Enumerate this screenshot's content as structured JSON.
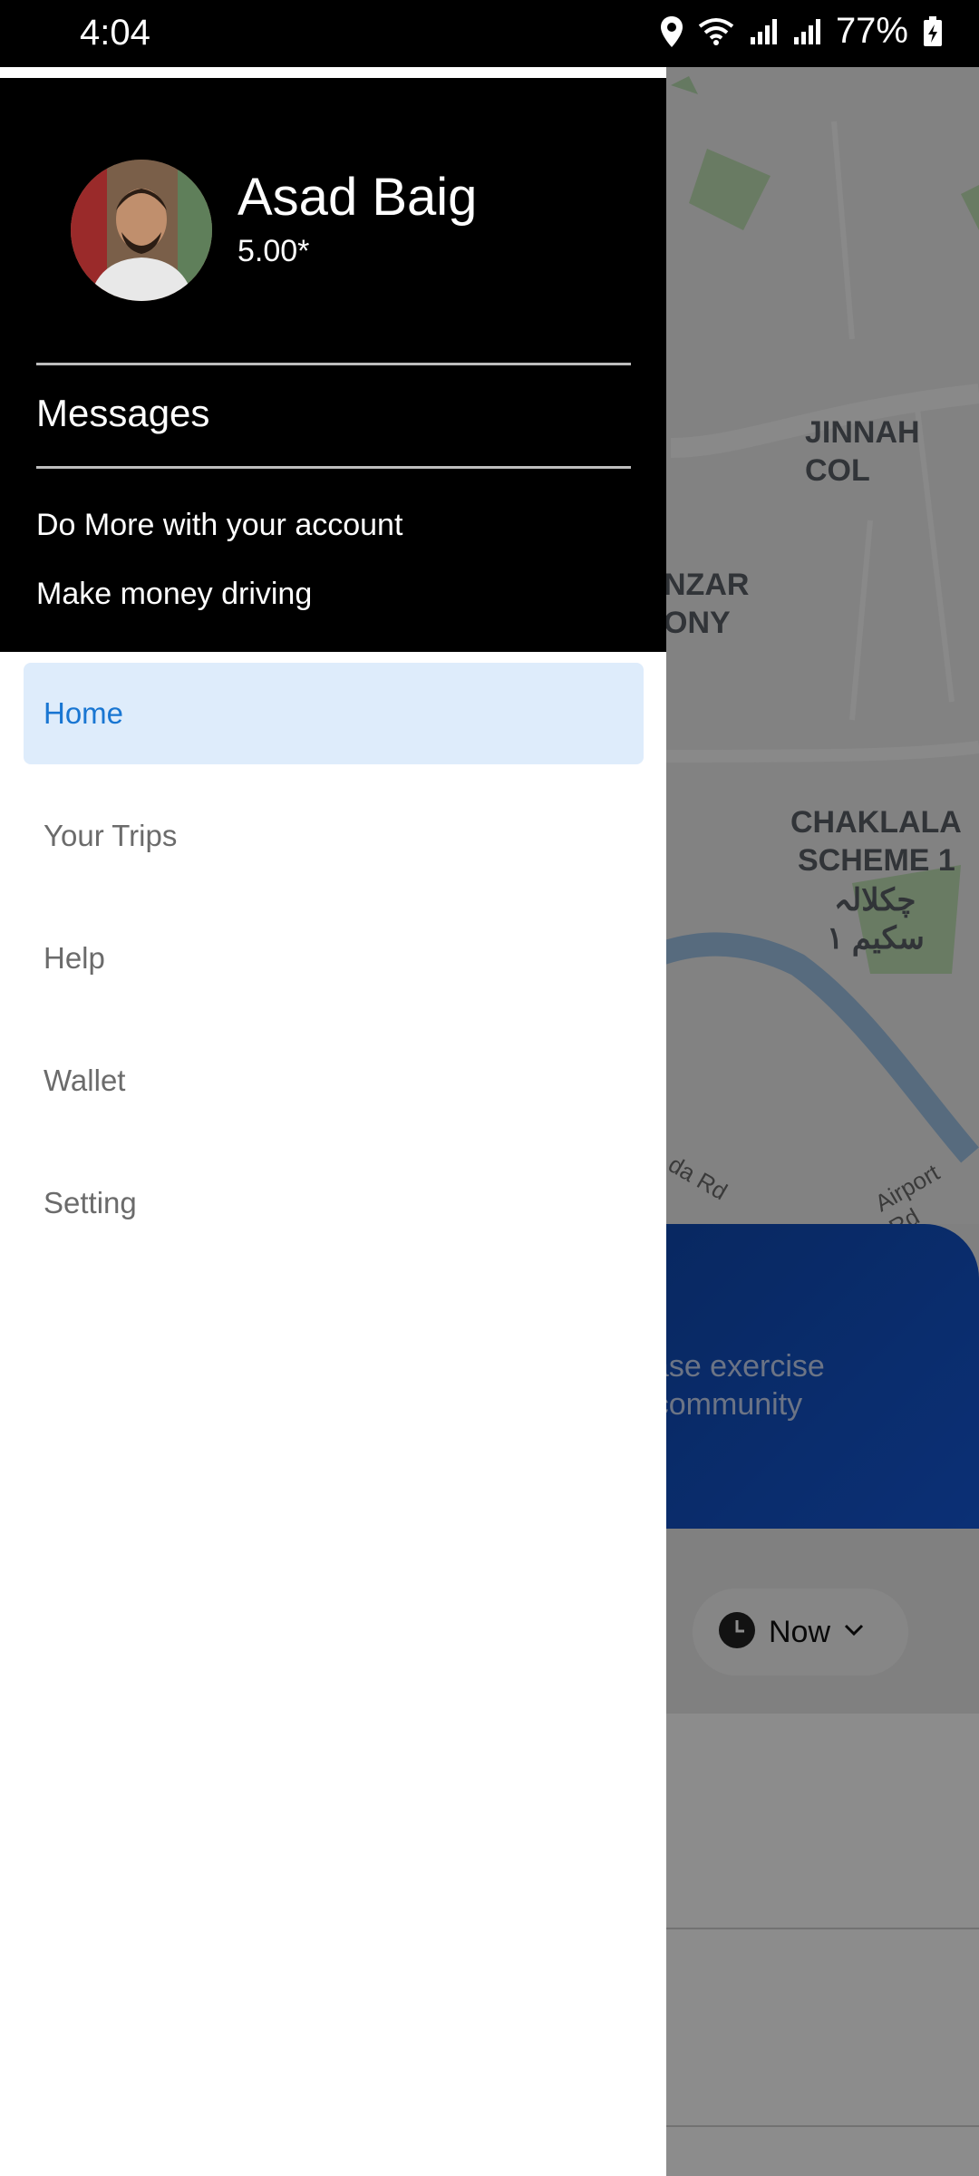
{
  "status_bar": {
    "time": "4:04",
    "battery": "77%",
    "icons": [
      "location-icon",
      "wifi-icon",
      "signal-icon",
      "signal-icon",
      "battery-charging-icon"
    ]
  },
  "drawer": {
    "user": {
      "name": "Asad Baig",
      "rating": "5.00*"
    },
    "messages_label": "Messages",
    "links": {
      "do_more": "Do More with your account",
      "make_money": "Make money driving"
    },
    "menu": [
      {
        "label": "Home",
        "active": true
      },
      {
        "label": "Your Trips",
        "active": false
      },
      {
        "label": "Help",
        "active": false
      },
      {
        "label": "Wallet",
        "active": false
      },
      {
        "label": "Setting",
        "active": false
      }
    ]
  },
  "background": {
    "map_labels": {
      "jinnah": "JINNAH COL",
      "manzar_1": "NZAR",
      "manzar_2": "ONY",
      "chaklala_1": "CHAKLALA",
      "chaklala_2": "SCHEME 1",
      "chaklala_urdu_1": "چکلالہ",
      "chaklala_urdu_2": "سکیم ١",
      "road_1": "da Rd",
      "road_2": "Airport Rd"
    },
    "promo_lines": [
      "ease exercise",
      "r community"
    ],
    "now_button": "Now"
  },
  "colors": {
    "drawer_header_bg": "#000000",
    "active_item_bg": "#deecfb",
    "active_item_text": "#1976d2",
    "inactive_item_text": "#6b6b6b",
    "promo_card": "#1558d6"
  }
}
